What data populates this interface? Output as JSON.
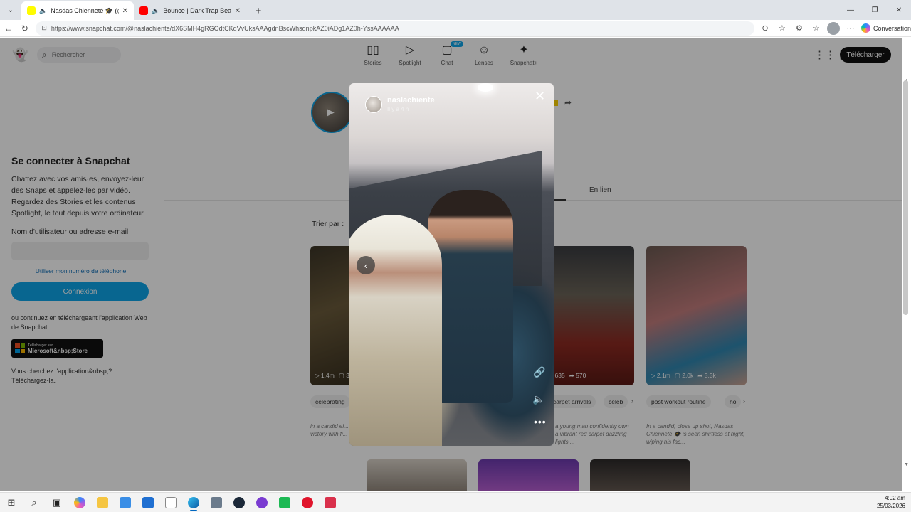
{
  "browser": {
    "tabs": [
      {
        "title": "Nasdas Chienneté 🎓 (@nasla",
        "favicon_color": "#FFFC00",
        "active": true
      },
      {
        "title": "Bounce | Dark Trap Beat | Free",
        "favicon_color": "#FF0000",
        "active": false
      }
    ],
    "url": "https://www.snapchat.com/@naslachiente/dX6SMH4gRGOdtCKqVvUksAAAgdnBscWhsdnpkAZ0iADg1AZ0h-YssAAAAAA",
    "copilot_label": "Conversation"
  },
  "header": {
    "search_placeholder": "Rechercher",
    "nav": [
      {
        "label": "Stories",
        "icon": "stories-icon",
        "glyph": "▯▯"
      },
      {
        "label": "Spotlight",
        "icon": "spotlight-icon",
        "glyph": "▷"
      },
      {
        "label": "Chat",
        "icon": "chat-icon",
        "glyph": "▢",
        "badge": "NEW"
      },
      {
        "label": "Lenses",
        "icon": "lenses-icon",
        "glyph": "☺"
      },
      {
        "label": "Snapchat+",
        "icon": "snapchat-plus-icon",
        "glyph": "✦"
      }
    ],
    "download_label": "Télécharger"
  },
  "login": {
    "title": "Se connecter à Snapchat",
    "description": "Chattez avec vos amis·es, envoyez-leur des Snaps et appelez-les par vidéo. Regardez des Stories et les contenus Spotlight, le tout depuis votre ordinateur.",
    "username_label": "Nom d'utilisateur ou adresse e-mail",
    "phone_link": "Utiliser mon numéro de téléphone",
    "connect_label": "Connexion",
    "alt_text": "ou continuez en téléchargeant l'application Web de Snapchat",
    "store_small": "Télécharger sur",
    "store_big": "Microsoft&nbsp;Store",
    "looking_text": "Vous cherchez l'application&nbsp;? Téléchargez-la."
  },
  "profile": {
    "tab_label": "En lien",
    "sort_label": "Trier par :"
  },
  "cards": [
    {
      "stats": [
        "1.4m",
        "3"
      ],
      "chip": "celebrating",
      "caption": "in a candid el... Nasdas Chien... a victory with fi..."
    },
    {
      "stats": [
        "m",
        "635",
        "570"
      ],
      "chip": "carpet arrivals",
      "chip2": "celeb",
      "caption": "a young man confidently own a vibrant red carpet dazzling lights,..."
    },
    {
      "stats": [
        "2.1m",
        "2.0k",
        "3.3k"
      ],
      "chip": "post workout routine",
      "chip2": "ho",
      "caption": "In a candid, close up shot, Nasdas Chienneté 🎓 is seen shirtless at night, wiping his fac..."
    }
  ],
  "story": {
    "username": "naslachiente",
    "time": "Il y a 4 h"
  },
  "taskbar": {
    "time": "4:02 am",
    "date": "25/03/2026"
  }
}
